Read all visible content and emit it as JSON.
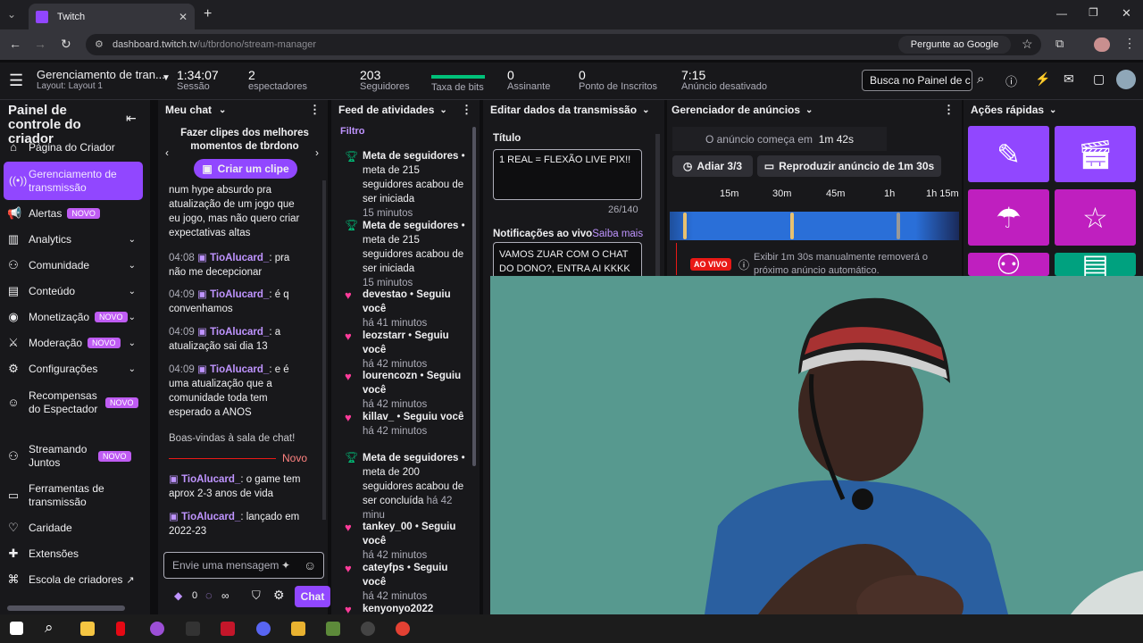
{
  "browser": {
    "tab_title": "Twitch",
    "url_host": "dashboard.twitch.tv",
    "url_path": "/u/tbrdono/stream-manager",
    "google_btn": "Pergunte ao Google"
  },
  "header": {
    "title": "Gerenciamento de tran...",
    "layout": "Layout: Layout 1",
    "stats": [
      {
        "v": "1:34:07",
        "l": "Sessão"
      },
      {
        "v": "2",
        "l": "espectadores"
      },
      {
        "v": "203",
        "l": "Seguidores"
      },
      {
        "v": "",
        "l": "Taxa de bits"
      },
      {
        "v": "0",
        "l": "Assinante"
      },
      {
        "v": "0",
        "l": "Ponto de Inscritos"
      },
      {
        "v": "7:15",
        "l": "Anúncio desativado"
      }
    ],
    "search_placeholder": "Busca no Painel de c"
  },
  "sidebar": {
    "title": "Painel de controle do criador",
    "items": [
      {
        "label": "Página do Criador"
      },
      {
        "label": "Gerenciamento de transmissão"
      },
      {
        "label": "Alertas",
        "badge": "NOVO"
      },
      {
        "label": "Analytics"
      },
      {
        "label": "Comunidade"
      },
      {
        "label": "Conteúdo"
      },
      {
        "label": "Monetização",
        "badge": "NOVO"
      },
      {
        "label": "Moderação",
        "badge": "NOVO"
      },
      {
        "label": "Configurações"
      },
      {
        "label": "Recompensas do Espectador",
        "badge": "NOVO"
      },
      {
        "label": "Streamando Juntos",
        "badge": "NOVO"
      },
      {
        "label": "Ferramentas de transmissão"
      },
      {
        "label": "Caridade"
      },
      {
        "label": "Extensões"
      },
      {
        "label": "Escola de criadores"
      }
    ]
  },
  "chat": {
    "title": "Meu chat",
    "clip_text": "Fazer clipes dos melhores momentos de tbrdono",
    "clip_btn": "Criar um clipe",
    "msgs": [
      {
        "time": "",
        "user": "",
        "text": "num hype absurdo pra atualização de um jogo que eu jogo, mas não quero criar expectativas altas"
      },
      {
        "time": "04:08",
        "user": "TioAlucard_",
        "text": ": pra não me decepcionar"
      },
      {
        "time": "04:09",
        "user": "TioAlucard_",
        "text": ": é q convenhamos"
      },
      {
        "time": "04:09",
        "user": "TioAlucard_",
        "text": ": a atualização sai dia 13"
      },
      {
        "time": "04:09",
        "user": "TioAlucard_",
        "text": ": e é uma atualização que a comunidade toda tem esperado a ANOS"
      }
    ],
    "welcome": "Boas-vindas à sala de chat!",
    "new_label": "Novo",
    "msgs2": [
      {
        "user": "TioAlucard_",
        "text": ": o game tem aprox 2-3 anos de vida"
      },
      {
        "user": "TioAlucard_",
        "text": ": lançado em 2022-23"
      }
    ],
    "input_placeholder": "Envie uma mensagem",
    "points": "0",
    "infinity": "∞",
    "send": "Chat"
  },
  "feed": {
    "title": "Feed de atividades",
    "filter": "Filtro",
    "items": [
      {
        "name": "Meta de seguidores",
        "sep": " • ",
        "text": "meta de 215 seguidores acabou de ser iniciada",
        "time": "15 minutos"
      },
      {
        "name": "Meta de seguidores",
        "sep": " • ",
        "text": "meta de 215 seguidores acabou de ser iniciada",
        "time": "15 minutos"
      },
      {
        "name": "devestao",
        "sep": " • ",
        "text": "Seguiu você",
        "time": "há 41 minutos"
      },
      {
        "name": "leozstarr",
        "sep": " • ",
        "text": "Seguiu você",
        "time": "há 42 minutos"
      },
      {
        "name": "lourencozn",
        "sep": " • ",
        "text": "Seguiu você",
        "time": "há 42 minutos"
      },
      {
        "name": "killav_",
        "sep": " • ",
        "text": "Seguiu você",
        "time": "há 42 minutos"
      },
      {
        "name": "Meta de seguidores",
        "sep": " • ",
        "text": "meta de 200 seguidores acabou de ser concluída",
        "time": "há 42 minu"
      },
      {
        "name": "tankey_00",
        "sep": " • ",
        "text": "Seguiu você",
        "time": "há 42 minutos"
      },
      {
        "name": "cateyfps",
        "sep": " • ",
        "text": "Seguiu você",
        "time": "há 42 minutos"
      },
      {
        "name": "kenyonyo2022",
        "sep": "",
        "text": "",
        "time": ""
      }
    ]
  },
  "edit": {
    "title": "Editar dados da transmissão",
    "title_label": "Título",
    "title_value": "1 REAL = FLEXÃO LIVE PIX!!",
    "count": "26/140",
    "notif_label": "Notificações ao vivo",
    "saiba": "Saiba mais",
    "notif_value": "VAMOS ZUAR COM O CHAT DO DONO?, ENTRA AI KKKK"
  },
  "ads": {
    "title": "Gerenciador de anúncios",
    "starts_label": "O anúncio começa em",
    "starts_value": "1m 42s",
    "snooze": "Adiar 3/3",
    "run": "Reproduzir anúncio de 1m 30s",
    "ticks": [
      "15m",
      "30m",
      "45m",
      "1h",
      "1h 15m"
    ],
    "live": "AO VIVO",
    "info": "Exibir 1m 30s manualmente removerá o próximo anúncio automático."
  },
  "quick": {
    "title": "Ações rápidas",
    "colors": {
      "purple": "#9147ff",
      "magenta": "#bf1fbf",
      "green": "#00a17f"
    }
  }
}
